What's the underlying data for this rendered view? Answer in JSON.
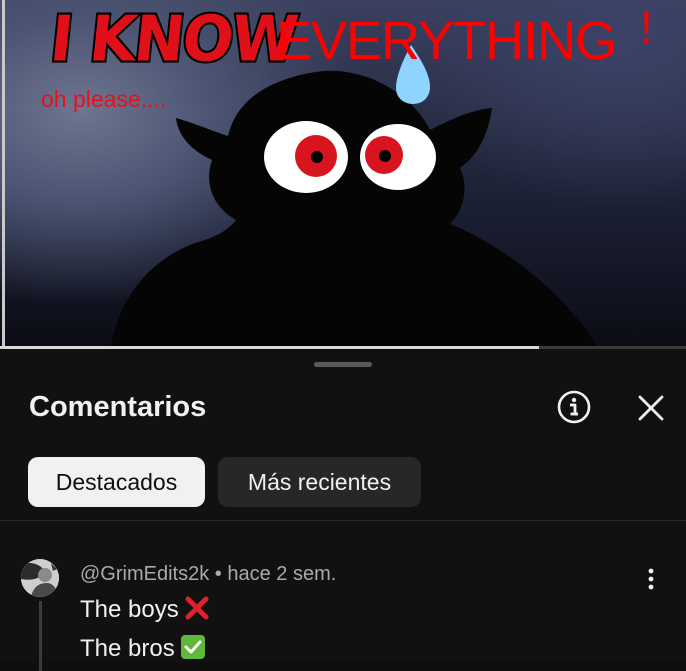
{
  "video": {
    "meme_title_part1": "I KNOW",
    "meme_title_part2": "EVERYTHING",
    "meme_exclamation": "!",
    "meme_subtitle": "oh please....",
    "progress": 0.786
  },
  "comments_panel": {
    "title": "Comentarios",
    "info_icon": "info-icon",
    "close_icon": "close-icon",
    "chips": [
      {
        "label": "Destacados",
        "active": true
      },
      {
        "label": "Más recientes",
        "active": false
      }
    ],
    "comments": [
      {
        "author": "@GrimEdits2k",
        "time": "hace 2 sem.",
        "meta_separator": " • ",
        "lines": [
          "The boys",
          "The bros"
        ],
        "line_emojis": [
          "cross-mark-emoji",
          "check-mark-emoji"
        ]
      }
    ]
  },
  "colors": {
    "background": "#0f0f0f",
    "panel": "#111111",
    "chip_active_bg": "#f1f1f1",
    "chip_inactive_bg": "#272727",
    "meme_red": "#ff0000",
    "text_primary": "#f1f1f1",
    "text_secondary": "#aaaaaa"
  }
}
